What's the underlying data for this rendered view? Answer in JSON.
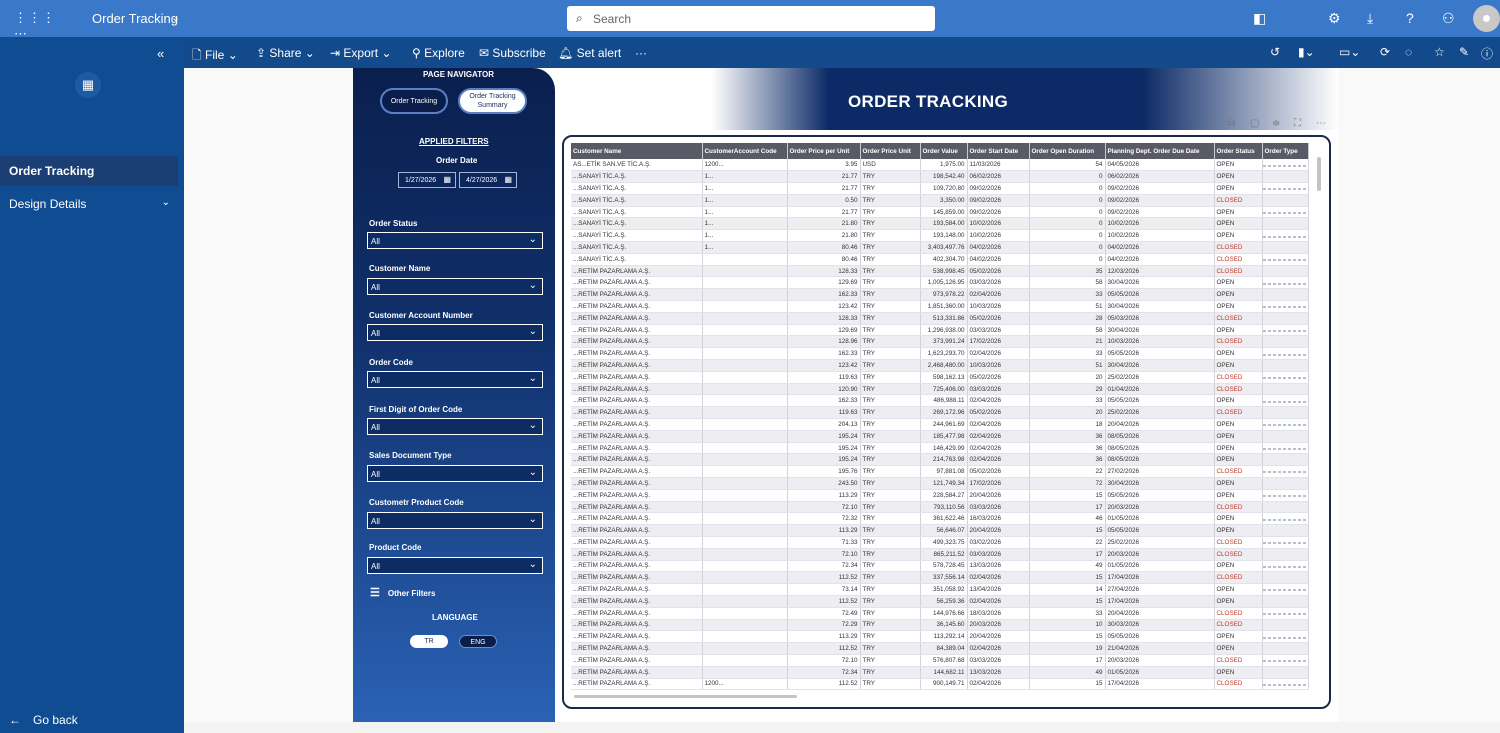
{
  "topbar": {
    "app_title": "Order Tracking",
    "search_placeholder": "Search",
    "icons": [
      "waffle-icon",
      "layout-icon",
      "settings-icon",
      "download-icon",
      "help-icon",
      "share-people-icon",
      "avatar"
    ]
  },
  "leftnav": {
    "items": [
      {
        "label": "Order Tracking"
      },
      {
        "label": "Design Details"
      }
    ],
    "go_back": "Go back"
  },
  "toolbar": {
    "file": "File",
    "share": "Share",
    "export": "Export",
    "explore": "Explore",
    "subscribe": "Subscribe",
    "set_alert": "Set alert",
    "more": "···"
  },
  "report": {
    "title": "ORDER TRACKING",
    "page_navigator": "PAGE NAVIGATOR",
    "nav_buttons": [
      "Order Tracking",
      "Order Tracking Summary"
    ],
    "applied_filters": "APPLIED FILTERS",
    "order_date_label": "Order Date",
    "date_from": "1/27/2026",
    "date_to": "4/27/2026",
    "filters": [
      {
        "label": "Order Status",
        "value": "All"
      },
      {
        "label": "Customer Name",
        "value": "All"
      },
      {
        "label": "Customer Account Number",
        "value": "All"
      },
      {
        "label": "Order Code",
        "value": "All"
      },
      {
        "label": "First Digit of Order Code",
        "value": "All"
      },
      {
        "label": "Sales Document Type",
        "value": "All"
      },
      {
        "label": "Custometr Product Code",
        "value": "All"
      },
      {
        "label": "Product Code",
        "value": "All"
      }
    ],
    "other_filters": "Other Filters",
    "language_label": "LANGUAGE",
    "languages": [
      "TR",
      "ENG"
    ]
  },
  "table": {
    "columns": [
      "Customer Name",
      "CustomerAccount Code",
      "Order Price per Unit",
      "Order Price Unit",
      "Order Value",
      "Order Start Date",
      "Order Open Duration",
      "Planning Dept. Order Due Date",
      "Order Status",
      "Order Type"
    ],
    "rows": [
      [
        "AS...ETİK SAN.VE TİC.A.Ş.",
        "1200...",
        "3.95",
        "USD",
        "1,975.00",
        "11/03/2026",
        "54",
        "04/05/2026",
        "OPEN"
      ],
      [
        "...SANAYİ TİC.A.Ş.",
        "1...",
        "21.77",
        "TRY",
        "198,542.40",
        "06/02/2026",
        "0",
        "06/02/2026",
        "OPEN"
      ],
      [
        "...SANAYİ TİC.A.Ş.",
        "1...",
        "21.77",
        "TRY",
        "109,720.80",
        "09/02/2026",
        "0",
        "09/02/2026",
        "OPEN"
      ],
      [
        "...SANAYİ TİC.A.Ş.",
        "1...",
        "0.50",
        "TRY",
        "3,350.00",
        "09/02/2026",
        "0",
        "09/02/2026",
        "CLOSED"
      ],
      [
        "...SANAYİ TİC.A.Ş.",
        "1...",
        "21.77",
        "TRY",
        "145,859.00",
        "09/02/2026",
        "0",
        "09/02/2026",
        "OPEN"
      ],
      [
        "...SANAYİ TİC.A.Ş.",
        "1...",
        "21.80",
        "TRY",
        "193,584.00",
        "10/02/2026",
        "0",
        "10/02/2026",
        "OPEN"
      ],
      [
        "...SANAYİ TİC.A.Ş.",
        "1...",
        "21.80",
        "TRY",
        "193,148.00",
        "10/02/2026",
        "0",
        "10/02/2026",
        "OPEN"
      ],
      [
        "...SANAYİ TİC.A.Ş.",
        "1...",
        "80.46",
        "TRY",
        "3,403,497.76",
        "04/02/2026",
        "0",
        "04/02/2026",
        "CLOSED"
      ],
      [
        "...SANAYİ TİC.A.Ş.",
        "",
        "80.46",
        "TRY",
        "402,304.70",
        "04/02/2026",
        "0",
        "04/02/2026",
        "CLOSED"
      ],
      [
        "...RETİM PAZARLAMA A.Ş.",
        "",
        "128.33",
        "TRY",
        "538,998.45",
        "05/02/2026",
        "35",
        "12/03/2026",
        "CLOSED"
      ],
      [
        "...RETİM PAZARLAMA A.Ş.",
        "",
        "129.69",
        "TRY",
        "1,005,126.95",
        "03/03/2026",
        "58",
        "30/04/2026",
        "OPEN"
      ],
      [
        "...RETİM PAZARLAMA A.Ş.",
        "",
        "162.33",
        "TRY",
        "973,978.22",
        "02/04/2026",
        "33",
        "05/05/2026",
        "OPEN"
      ],
      [
        "...RETİM PAZARLAMA A.Ş.",
        "",
        "123.42",
        "TRY",
        "1,851,360.00",
        "10/03/2026",
        "51",
        "30/04/2026",
        "OPEN"
      ],
      [
        "...RETİM PAZARLAMA A.Ş.",
        "",
        "128.33",
        "TRY",
        "513,331.86",
        "05/02/2026",
        "28",
        "05/03/2026",
        "CLOSED"
      ],
      [
        "...RETİM PAZARLAMA A.Ş.",
        "",
        "129.69",
        "TRY",
        "1,296,938.00",
        "03/03/2026",
        "58",
        "30/04/2026",
        "OPEN"
      ],
      [
        "...RETİM PAZARLAMA A.Ş.",
        "",
        "128.96",
        "TRY",
        "373,991.24",
        "17/02/2026",
        "21",
        "10/03/2026",
        "CLOSED"
      ],
      [
        "...RETİM PAZARLAMA A.Ş.",
        "",
        "162.33",
        "TRY",
        "1,623,293.70",
        "02/04/2026",
        "33",
        "05/05/2026",
        "OPEN"
      ],
      [
        "...RETİM PAZARLAMA A.Ş.",
        "",
        "123.42",
        "TRY",
        "2,468,480.00",
        "10/03/2026",
        "51",
        "30/04/2026",
        "OPEN"
      ],
      [
        "...RETİM PAZARLAMA A.Ş.",
        "",
        "119.63",
        "TRY",
        "598,162.13",
        "05/02/2026",
        "20",
        "25/02/2026",
        "CLOSED"
      ],
      [
        "...RETİM PAZARLAMA A.Ş.",
        "",
        "120.90",
        "TRY",
        "725,406.00",
        "03/03/2026",
        "29",
        "01/04/2026",
        "CLOSED"
      ],
      [
        "...RETİM PAZARLAMA A.Ş.",
        "",
        "162.33",
        "TRY",
        "486,988.11",
        "02/04/2026",
        "33",
        "05/05/2026",
        "OPEN"
      ],
      [
        "...RETİM PAZARLAMA A.Ş.",
        "",
        "119.63",
        "TRY",
        "269,172.96",
        "05/02/2026",
        "20",
        "25/02/2026",
        "CLOSED"
      ],
      [
        "...RETİM PAZARLAMA A.Ş.",
        "",
        "204.13",
        "TRY",
        "244,961.69",
        "02/04/2026",
        "18",
        "20/04/2026",
        "OPEN"
      ],
      [
        "...RETİM PAZARLAMA A.Ş.",
        "",
        "195.24",
        "TRY",
        "185,477.98",
        "02/04/2026",
        "36",
        "08/05/2026",
        "OPEN"
      ],
      [
        "...RETİM PAZARLAMA A.Ş.",
        "",
        "195.24",
        "TRY",
        "146,429.99",
        "02/04/2026",
        "36",
        "08/05/2026",
        "OPEN"
      ],
      [
        "...RETİM PAZARLAMA A.Ş.",
        "",
        "195.24",
        "TRY",
        "214,763.98",
        "02/04/2026",
        "36",
        "08/05/2026",
        "OPEN"
      ],
      [
        "...RETİM PAZARLAMA A.Ş.",
        "",
        "195.76",
        "TRY",
        "97,881.08",
        "05/02/2026",
        "22",
        "27/02/2026",
        "CLOSED"
      ],
      [
        "...RETİM PAZARLAMA A.Ş.",
        "",
        "243.50",
        "TRY",
        "121,749.34",
        "17/02/2026",
        "72",
        "30/04/2026",
        "OPEN"
      ],
      [
        "...RETİM PAZARLAMA A.Ş.",
        "",
        "113.29",
        "TRY",
        "228,584.27",
        "20/04/2026",
        "15",
        "05/05/2026",
        "OPEN"
      ],
      [
        "...RETİM PAZARLAMA A.Ş.",
        "",
        "72.10",
        "TRY",
        "793,110.56",
        "03/03/2026",
        "17",
        "20/03/2026",
        "CLOSED"
      ],
      [
        "...RETİM PAZARLAMA A.Ş.",
        "",
        "72.32",
        "TRY",
        "361,622.46",
        "16/03/2026",
        "46",
        "01/05/2026",
        "OPEN"
      ],
      [
        "...RETİM PAZARLAMA A.Ş.",
        "",
        "113.29",
        "TRY",
        "56,646.07",
        "20/04/2026",
        "15",
        "05/05/2026",
        "OPEN"
      ],
      [
        "...RETİM PAZARLAMA A.Ş.",
        "",
        "71.33",
        "TRY",
        "499,323.75",
        "03/02/2026",
        "22",
        "25/02/2026",
        "CLOSED"
      ],
      [
        "...RETİM PAZARLAMA A.Ş.",
        "",
        "72.10",
        "TRY",
        "865,211.52",
        "03/03/2026",
        "17",
        "20/03/2026",
        "CLOSED"
      ],
      [
        "...RETİM PAZARLAMA A.Ş.",
        "",
        "72.34",
        "TRY",
        "578,728.45",
        "13/03/2026",
        "49",
        "01/05/2026",
        "OPEN"
      ],
      [
        "...RETİM PAZARLAMA A.Ş.",
        "",
        "112.52",
        "TRY",
        "337,556.14",
        "02/04/2026",
        "15",
        "17/04/2026",
        "CLOSED"
      ],
      [
        "...RETİM PAZARLAMA A.Ş.",
        "",
        "73.14",
        "TRY",
        "351,058.92",
        "13/04/2026",
        "14",
        "27/04/2026",
        "OPEN"
      ],
      [
        "...RETİM PAZARLAMA A.Ş.",
        "",
        "112.52",
        "TRY",
        "56,259.36",
        "02/04/2026",
        "15",
        "17/04/2026",
        "OPEN"
      ],
      [
        "...RETİM PAZARLAMA A.Ş.",
        "",
        "72.49",
        "TRY",
        "144,976.66",
        "18/03/2026",
        "33",
        "20/04/2026",
        "CLOSED"
      ],
      [
        "...RETİM PAZARLAMA A.Ş.",
        "",
        "72.29",
        "TRY",
        "36,145.60",
        "20/03/2026",
        "10",
        "30/03/2026",
        "CLOSED"
      ],
      [
        "...RETİM PAZARLAMA A.Ş.",
        "",
        "113.29",
        "TRY",
        "113,292.14",
        "20/04/2026",
        "15",
        "05/05/2026",
        "OPEN"
      ],
      [
        "...RETİM PAZARLAMA A.Ş.",
        "",
        "112.52",
        "TRY",
        "84,389.04",
        "02/04/2026",
        "19",
        "21/04/2026",
        "OPEN"
      ],
      [
        "...RETİM PAZARLAMA A.Ş.",
        "",
        "72.10",
        "TRY",
        "576,807.68",
        "03/03/2026",
        "17",
        "20/03/2026",
        "CLOSED"
      ],
      [
        "...RETİM PAZARLAMA A.Ş.",
        "",
        "72.34",
        "TRY",
        "144,682.11",
        "13/03/2026",
        "49",
        "01/05/2026",
        "OPEN"
      ],
      [
        "...RETİM PAZARLAMA A.Ş.",
        "1200...",
        "112.52",
        "TRY",
        "900,149.71",
        "02/04/2026",
        "15",
        "17/04/2026",
        "CLOSED"
      ]
    ]
  },
  "colors": {
    "topbar": "#3a78c9",
    "leftnav": "#0f4c91",
    "toolbar": "#134a8c",
    "closed_status": "#c0392b"
  }
}
